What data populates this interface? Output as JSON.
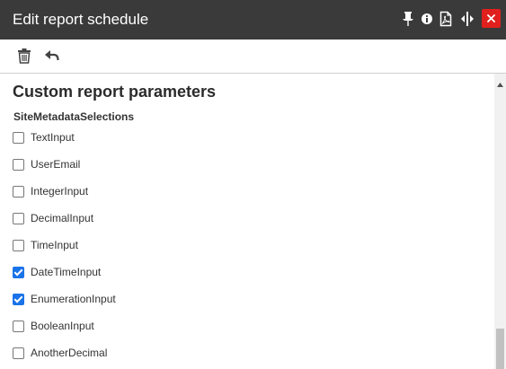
{
  "window": {
    "title": "Edit report schedule",
    "header_icons": [
      "pin-icon",
      "info-icon",
      "pdf-icon",
      "resize-icon",
      "close-icon"
    ],
    "close_color": "#e0201d",
    "titlebar_color": "#3a3a3a"
  },
  "toolbar": {
    "icons": [
      "trash-icon",
      "undo-icon"
    ]
  },
  "main": {
    "section_title": "Custom report parameters",
    "group_label": "SiteMetadataSelections",
    "options": [
      {
        "label": "TextInput",
        "checked": false
      },
      {
        "label": "UserEmail",
        "checked": false
      },
      {
        "label": "IntegerInput",
        "checked": false
      },
      {
        "label": "DecimalInput",
        "checked": false
      },
      {
        "label": "TimeInput",
        "checked": false
      },
      {
        "label": "DateTimeInput",
        "checked": true
      },
      {
        "label": "EnumerationInput",
        "checked": true
      },
      {
        "label": "BooleanInput",
        "checked": false
      },
      {
        "label": "AnotherDecimal",
        "checked": false
      }
    ],
    "checkbox_accent": "#1a73e8"
  }
}
